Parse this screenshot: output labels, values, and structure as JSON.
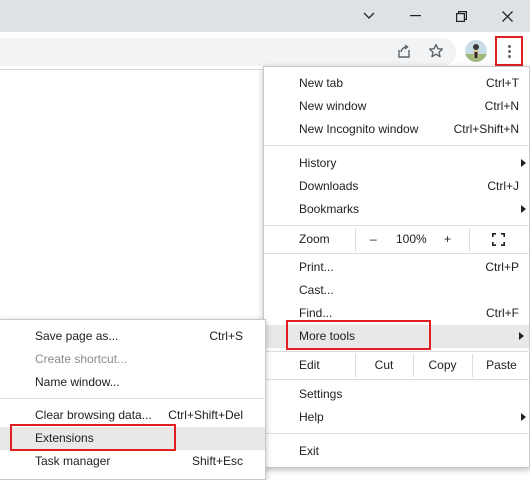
{
  "menu": {
    "group1": [
      {
        "label": "New tab",
        "shortcut": "Ctrl+T"
      },
      {
        "label": "New window",
        "shortcut": "Ctrl+N"
      },
      {
        "label": "New Incognito window",
        "shortcut": "Ctrl+Shift+N"
      }
    ],
    "group2": [
      {
        "label": "History"
      },
      {
        "label": "Downloads",
        "shortcut": "Ctrl+J"
      },
      {
        "label": "Bookmarks"
      }
    ],
    "zoom": {
      "label": "Zoom",
      "minus": "–",
      "value": "100%",
      "plus": "+"
    },
    "group3": [
      {
        "label": "Print...",
        "shortcut": "Ctrl+P"
      },
      {
        "label": "Cast..."
      },
      {
        "label": "Find...",
        "shortcut": "Ctrl+F"
      },
      {
        "label": "More tools"
      }
    ],
    "edit": {
      "label": "Edit",
      "cut": "Cut",
      "copy": "Copy",
      "paste": "Paste"
    },
    "group4": [
      {
        "label": "Settings"
      },
      {
        "label": "Help"
      }
    ],
    "exit": {
      "label": "Exit"
    }
  },
  "submenu": {
    "group1": [
      {
        "label": "Save page as...",
        "shortcut": "Ctrl+S"
      },
      {
        "label": "Create shortcut..."
      },
      {
        "label": "Name window..."
      }
    ],
    "group2": [
      {
        "label": "Clear browsing data...",
        "shortcut": "Ctrl+Shift+Del"
      },
      {
        "label": "Extensions"
      },
      {
        "label": "Task manager",
        "shortcut": "Shift+Esc"
      }
    ]
  },
  "colors": {
    "highlight_box": "#e02020",
    "hover": "#e8e8e8"
  }
}
